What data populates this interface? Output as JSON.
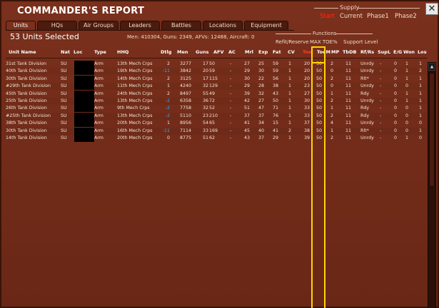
{
  "window": {
    "title": "COMMANDER'S REPORT",
    "close_label": "✕"
  },
  "supply": {
    "title": "Supply",
    "tabs": [
      {
        "label": "Start",
        "active": true
      },
      {
        "label": "Current",
        "active": false
      },
      {
        "label": "Phase1",
        "active": false
      },
      {
        "label": "Phase2",
        "active": false
      }
    ]
  },
  "tabs": [
    "Units",
    "HQs",
    "Air Groups",
    "Leaders",
    "Battles",
    "Locations",
    "Equipment"
  ],
  "selection": {
    "count_text": "53 Units Selected"
  },
  "summary": {
    "text": "Men: 410304, Guns: 2349, AFVs: 12488, Aircraft: 0"
  },
  "functions": {
    "title": "Functions",
    "refit": "Refit/Reserve",
    "max_toe": "MAX TOE%",
    "support": "Support Level"
  },
  "table": {
    "headers": [
      "Unit Name",
      "Nat",
      "Loc",
      "Type",
      "HHQ",
      "Dtlg",
      "Men",
      "Guns",
      "AFV",
      "AC",
      "Mrl",
      "Exp",
      "Fat",
      "CV",
      "Toe",
      "ToeM",
      "MP",
      "TbDB",
      "Rf/Rs",
      "SupL",
      "E/G",
      "Won",
      "Lost"
    ],
    "rows": [
      [
        "31st Tank Division",
        "SU",
        "",
        "Arm",
        "13th Mech Crps",
        "2",
        "3277",
        "17",
        "50",
        "-",
        "27",
        "25",
        "59",
        "1",
        "20",
        "50",
        "2",
        "11",
        "Unrdy",
        "-",
        "0",
        "1",
        "1"
      ],
      [
        "40th Tank Division",
        "SU",
        "",
        "Arm",
        "19th Mech Crps",
        "-11",
        "3842",
        "20",
        "59",
        "-",
        "29",
        "30",
        "59",
        "1",
        "20",
        "50",
        "0",
        "11",
        "Unrdy",
        "-",
        "0",
        "1",
        "2"
      ],
      [
        "30th Tank Division",
        "SU",
        "",
        "Arm",
        "14th Mech Crps",
        "2",
        "3125",
        "17",
        "115",
        "-",
        "30",
        "22",
        "56",
        "1",
        "20",
        "50",
        "2",
        "11",
        "Rlt*",
        "-",
        "0",
        "1",
        "1"
      ],
      [
        "#29th Tank Division",
        "SU",
        "",
        "Arm",
        "11th Mech Crps",
        "1",
        "4240",
        "32",
        "129",
        "-",
        "29",
        "28",
        "38",
        "1",
        "23",
        "50",
        "0",
        "11",
        "Unrdy",
        "-",
        "0",
        "0",
        "1"
      ],
      [
        "45th Tank Division",
        "SU",
        "",
        "Arm",
        "24th Mech Crps",
        "2",
        "8497",
        "55",
        "49",
        "-",
        "39",
        "32",
        "43",
        "1",
        "27",
        "50",
        "1",
        "11",
        "Rdy",
        "-",
        "0",
        "1",
        "1"
      ],
      [
        "25th Tank Division",
        "SU",
        "",
        "Arm",
        "13th Mech Crps",
        "-2",
        "6358",
        "36",
        "72",
        "-",
        "42",
        "27",
        "50",
        "1",
        "30",
        "50",
        "2",
        "11",
        "Unrdy",
        "-",
        "0",
        "1",
        "1"
      ],
      [
        "26th Tank Division",
        "SU",
        "",
        "Arm",
        "9th Mech Crps",
        "-2",
        "7758",
        "32",
        "52",
        "-",
        "51",
        "47",
        "71",
        "1",
        "33",
        "50",
        "1",
        "11",
        "Rdy",
        "-",
        "0",
        "0",
        "1"
      ],
      [
        "#25th Tank Division",
        "SU",
        "",
        "Arm",
        "13th Mech Crps",
        "-2",
        "5110",
        "23",
        "210",
        "-",
        "37",
        "37",
        "76",
        "1",
        "33",
        "50",
        "2",
        "11",
        "Rdy",
        "-",
        "0",
        "0",
        "1"
      ],
      [
        "38th Tank Division",
        "SU",
        "",
        "Arm",
        "20th Mech Crps",
        "1",
        "8956",
        "54",
        "65",
        "-",
        "41",
        "34",
        "15",
        "1",
        "37",
        "50",
        "4",
        "11",
        "Unrdy",
        "-",
        "0",
        "0",
        "0"
      ],
      [
        "30th Tank Division",
        "SU",
        "",
        "Arm",
        "16th Mech Crps",
        "-11",
        "7114",
        "33",
        "169",
        "-",
        "45",
        "40",
        "41",
        "2",
        "38",
        "50",
        "1",
        "11",
        "Rlt*",
        "-",
        "0",
        "0",
        "1"
      ],
      [
        "14th Tank Division",
        "SU",
        "",
        "Arm",
        "20th Mech Crps",
        "0",
        "8775",
        "51",
        "62",
        "-",
        "43",
        "37",
        "29",
        "1",
        "39",
        "50",
        "2",
        "11",
        "Unrdy",
        "-",
        "0",
        "1",
        "0"
      ]
    ]
  }
}
